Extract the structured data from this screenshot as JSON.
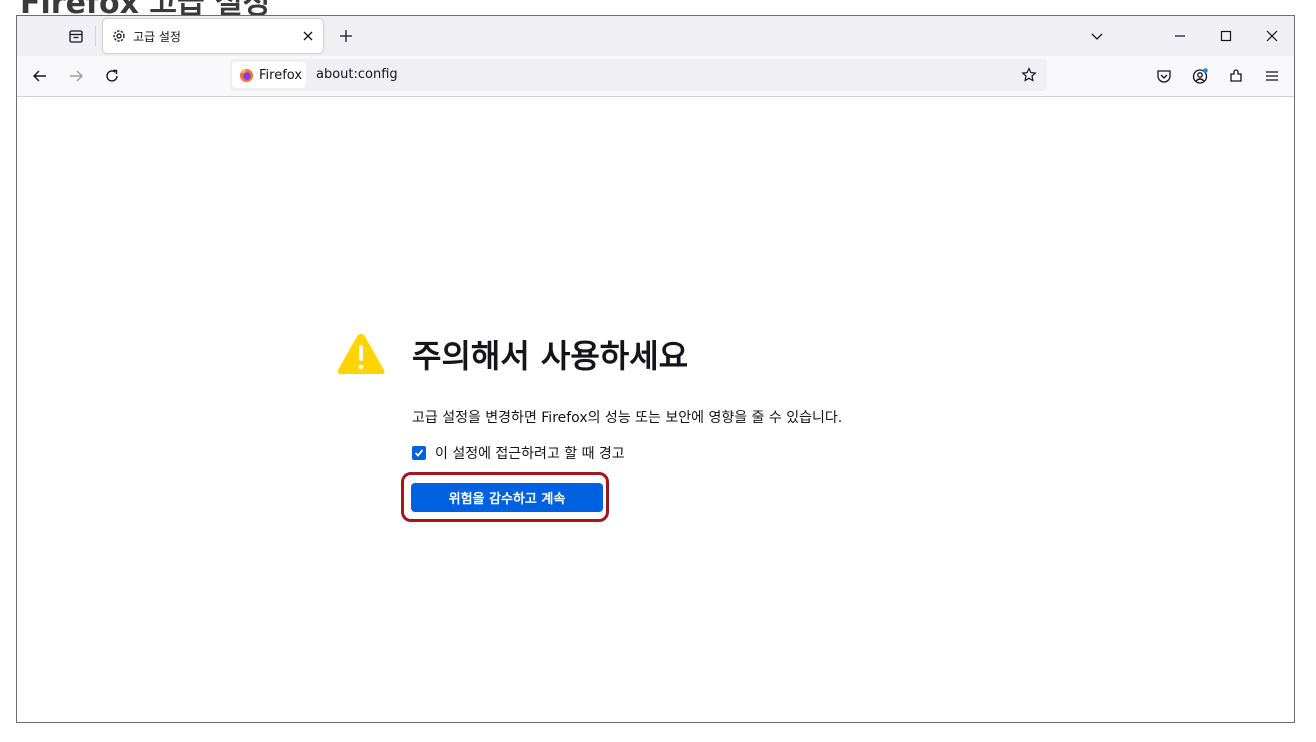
{
  "top_heading": "Firefox 고급 설정",
  "tabs": [
    {
      "title": "고급 설정"
    }
  ],
  "urlbar": {
    "identity_label": "Firefox",
    "url": "about:config"
  },
  "warning": {
    "title": "주의해서 사용하세요",
    "description": "고급 설정을 변경하면 Firefox의 성능 또는 보안에 영향을 줄 수 있습니다.",
    "checkbox_label": "이 설정에 접근하려고 할 때 경고",
    "checkbox_checked": true,
    "accept_button": "위험을 감수하고 계속"
  },
  "colors": {
    "accent": "#0061e0",
    "warning_icon": "#ffd400",
    "highlight_border": "#a4161f",
    "titlebar": "#f0f0f4"
  },
  "icons": {
    "tab_icon": "gear-icon",
    "warning": "warning-triangle-icon"
  }
}
